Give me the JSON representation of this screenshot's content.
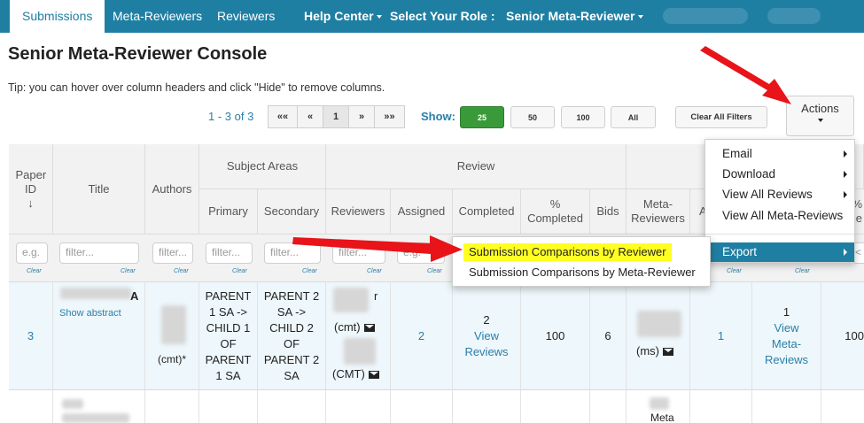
{
  "navbar": {
    "tabs": [
      "Submissions",
      "Meta-Reviewers",
      "Reviewers"
    ],
    "help_center": "Help Center",
    "select_role_label": "Select Your Role :",
    "role_value": "Senior Meta-Reviewer"
  },
  "page": {
    "title": "Senior Meta-Reviewer Console",
    "tip": "Tip: you can hover over column headers and click \"Hide\" to remove columns."
  },
  "pager": {
    "count": "1 - 3 of 3",
    "first": "««",
    "prev": "«",
    "current": "1",
    "next": "»",
    "last": "»»"
  },
  "show": {
    "label": "Show:",
    "options": [
      "25",
      "50",
      "100",
      "All"
    ],
    "selected": "25"
  },
  "toolbar": {
    "clear_filters": "Clear All Filters",
    "actions": "Actions"
  },
  "table": {
    "group_headers": {
      "subject_areas": "Subject Areas",
      "review": "Review"
    },
    "columns": {
      "paper_id": "Paper ID",
      "title": "Title",
      "authors": "Authors",
      "primary": "Primary",
      "secondary": "Secondary",
      "reviewers": "Reviewers",
      "assigned": "Assigned",
      "completed": "Completed",
      "pct_completed": "% Completed",
      "bids": "Bids",
      "meta_reviewers": "Meta-Reviewers",
      "a_partial": "A",
      "pct_partial": "%",
      "ple_partial": "ple"
    },
    "filter_placeholder": "filter...",
    "filter_short": "e.g.",
    "clear_label": "Clear",
    "extra_filter": "<",
    "row1": {
      "paper_id": "3",
      "title_suffix": "A",
      "show_abstract": "Show abstract",
      "author_tag": "(cmt)*",
      "primary": "PARENT 1 SA -> CHILD 1 OF PARENT 1 SA",
      "secondary": "PARENT 2 SA -> CHILD 2 OF PARENT 2 SA",
      "reviewer1_suffix": "r",
      "reviewer1_tag": "(cmt)",
      "reviewer2_tag": "(CMT)",
      "assigned": "2",
      "completed_count": "2",
      "completed_link": "View Reviews",
      "pct_completed": "100",
      "bids": "6",
      "meta_tag": "(ms)",
      "meta_assigned": "1",
      "meta_completed": "1",
      "meta_link": "View Meta-Reviews",
      "meta_pct": "100"
    },
    "row2": {
      "meta_partial": "Meta"
    }
  },
  "actions_menu": {
    "items": [
      "Email",
      "Download",
      "View All Reviews",
      "View All Meta-Reviews",
      "Export"
    ],
    "highlighted": "Export"
  },
  "export_submenu": {
    "items": [
      "Submission Comparisons by Reviewer",
      "Submission Comparisons by Meta-Reviewer"
    ],
    "highlighted": "Submission Comparisons by Reviewer"
  },
  "colors": {
    "navbar": "#1f7fa3",
    "link": "#2a7fa8",
    "show_selected": "#3a9a3a",
    "highlight": "#ffff22",
    "annotation_arrow": "#e8141a"
  }
}
